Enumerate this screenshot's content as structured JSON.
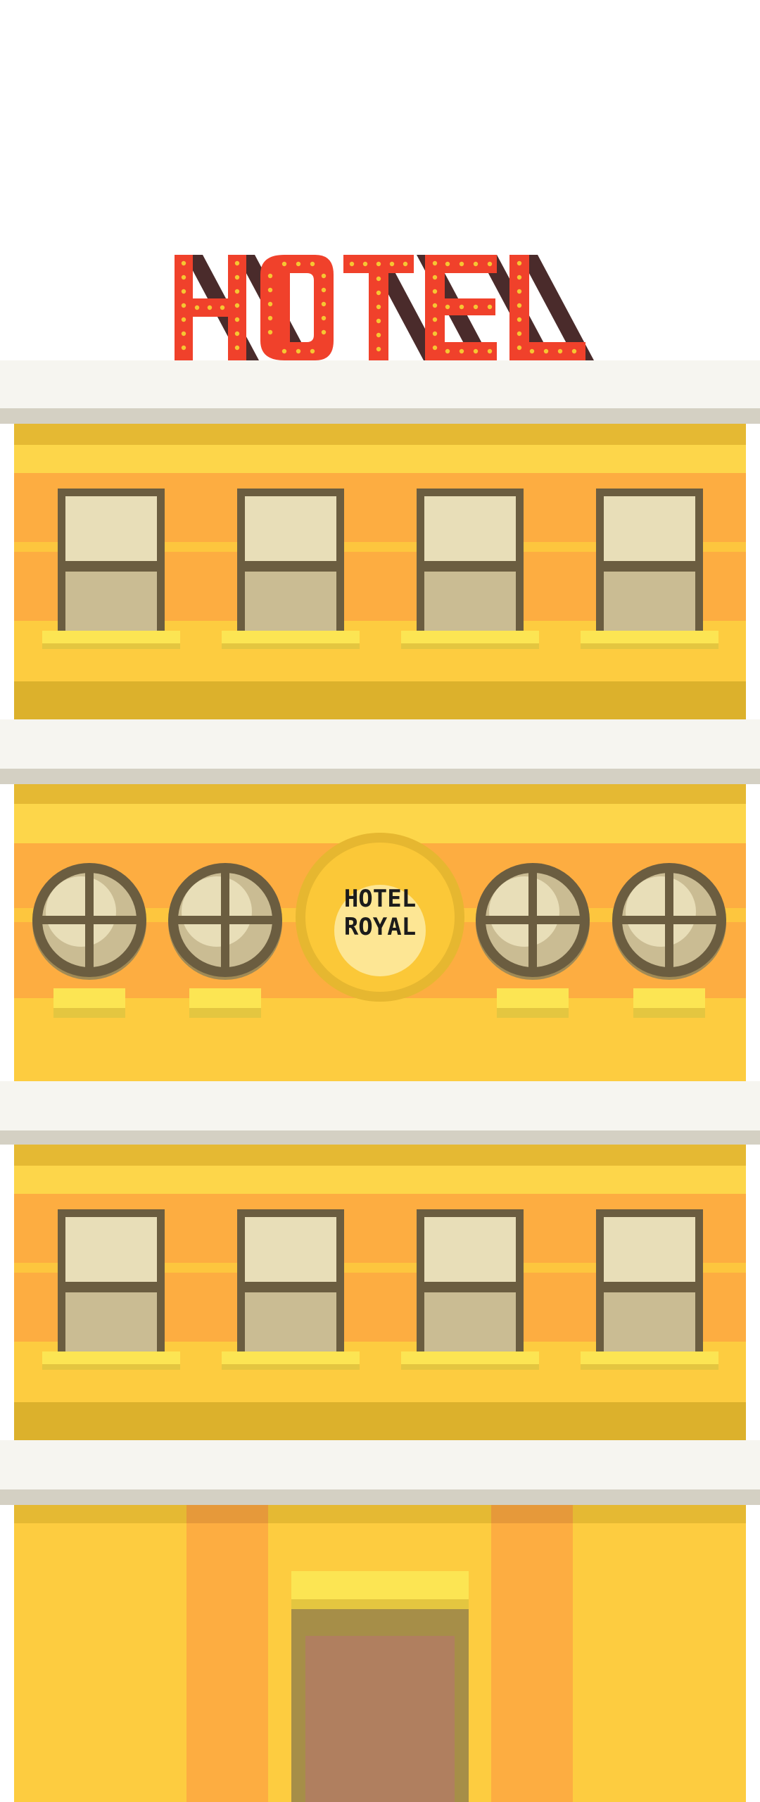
{
  "rooftop_sign": {
    "text": "HOTEL"
  },
  "center_sign": {
    "line1": "HOTEL",
    "line2": "ROYAL"
  },
  "colors": {
    "sign_red": "#f0412b",
    "sign_bulb": "#f6c632",
    "sign_shadow": "#4a2b2b",
    "ledge_white": "#f6f5f0",
    "ledge_shadow": "#d4d0c3",
    "facade_yellow": "#fdcc40",
    "facade_band_yellow": "#fdd64a",
    "facade_orange": "#fdad41",
    "facade_dark": "#dcb12c",
    "window_frame": "#6b5d40",
    "window_light": "#e8deb8",
    "window_dark": "#cabc93",
    "sill_yellow": "#fce553",
    "sill_shadow": "#e4c640",
    "door_brown": "#b07f5f",
    "door_frame": "#a68e48"
  }
}
